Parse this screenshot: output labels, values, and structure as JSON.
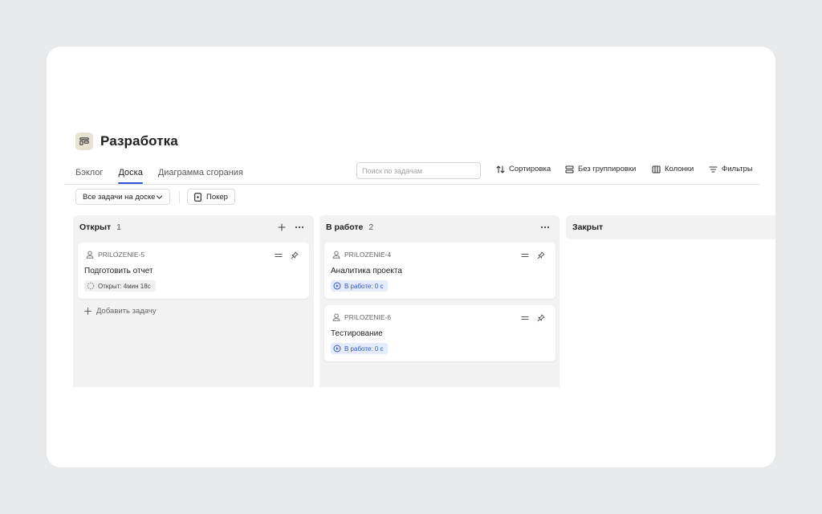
{
  "project": {
    "title": "Разработка",
    "logo_icon": "board-icon"
  },
  "tabs": [
    {
      "label": "Бэклог",
      "active": false
    },
    {
      "label": "Доска",
      "active": true
    },
    {
      "label": "Диаграмма сгорания",
      "active": false
    }
  ],
  "toolbar": {
    "search_placeholder": "Поиск по задачам",
    "sort_label": "Сортировка",
    "group_label": "Без группировки",
    "columns_label": "Колонки",
    "filters_label": "Фильтры"
  },
  "filter_row": {
    "scope_select": "Все задачи на доске",
    "poker_label": "Покер"
  },
  "columns": [
    {
      "title": "Открыт",
      "count": "1",
      "cards": [
        {
          "key": "PRILOZENIE-5",
          "title": "Подготовить отчет",
          "status": "Открыт: 4мин 18с"
        }
      ],
      "add_task_label": "Добавить задачу"
    },
    {
      "title": "В работе",
      "count": "2",
      "cards": [
        {
          "key": "PRILOZENIE-4",
          "title": "Аналитика проекта",
          "status": "В работе: 0 с"
        },
        {
          "key": "PRILOZENIE-6",
          "title": "Тестирование",
          "status": "В работе: 0 с"
        }
      ]
    },
    {
      "title": "Закрыт"
    }
  ],
  "colors": {
    "accent": "#2a4fd1",
    "status_work_bg": "#e4ecfb",
    "status_work_text": "#3358c7",
    "column_bg": "#f2f2f2",
    "page_bg": "#e8e9eb"
  }
}
